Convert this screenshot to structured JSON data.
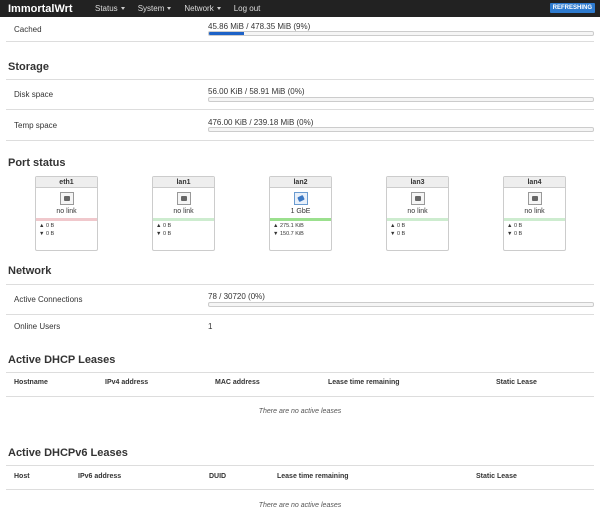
{
  "nav": {
    "brand": "ImmortalWrt",
    "menu": [
      {
        "label": "Status",
        "dropdown": true
      },
      {
        "label": "System",
        "dropdown": true
      },
      {
        "label": "Network",
        "dropdown": true
      },
      {
        "label": "Log out",
        "dropdown": false
      }
    ],
    "refresh_label": "REFRESHING",
    "refresh_color": "#2e7bcf"
  },
  "memory": {
    "cached_label": "Cached",
    "cached_value": "45.86 MiB / 478.35 MiB (9%)",
    "cached_fraction": 0.09
  },
  "storage": {
    "title": "Storage",
    "disk_label": "Disk space",
    "disk_value": "56.00 KiB / 58.91 MiB (0%)",
    "disk_fraction": 0.0,
    "temp_label": "Temp space",
    "temp_value": "476.00 KiB / 239.18 MiB (0%)",
    "temp_fraction": 0.0
  },
  "ports": {
    "title": "Port status",
    "items": [
      {
        "name": "eth1",
        "state": "no link",
        "up": false,
        "line_color": "#f0c8cc",
        "tx": "▲ 0 B",
        "rx": "▼ 0 B"
      },
      {
        "name": "lan1",
        "state": "no link",
        "up": false,
        "line_color": "#cdeccf",
        "tx": "▲ 0 B",
        "rx": "▼ 0 B"
      },
      {
        "name": "lan2",
        "state": "1 GbE",
        "up": true,
        "line_color": "#9be08e",
        "tx": "▲ 275.1 KiB",
        "rx": "▼ 150.7 KiB"
      },
      {
        "name": "lan3",
        "state": "no link",
        "up": false,
        "line_color": "#cdeccf",
        "tx": "▲ 0 B",
        "rx": "▼ 0 B"
      },
      {
        "name": "lan4",
        "state": "no link",
        "up": false,
        "line_color": "#cdeccf",
        "tx": "▲ 0 B",
        "rx": "▼ 0 B"
      }
    ]
  },
  "network": {
    "title": "Network",
    "connections_label": "Active Connections",
    "connections_value": "78 / 30720 (0%)",
    "connections_fraction": 0.0,
    "users_label": "Online Users",
    "users_value": "1"
  },
  "dhcp": {
    "title": "Active DHCP Leases",
    "headers": [
      "Hostname",
      "IPv4 address",
      "MAC address",
      "Lease time remaining",
      "Static Lease"
    ],
    "empty": "There are no active leases"
  },
  "dhcp6": {
    "title": "Active DHCPv6 Leases",
    "headers": [
      "Host",
      "IPv6 address",
      "DUID",
      "Lease time remaining",
      "Static Lease"
    ],
    "empty": "There are no active leases"
  }
}
